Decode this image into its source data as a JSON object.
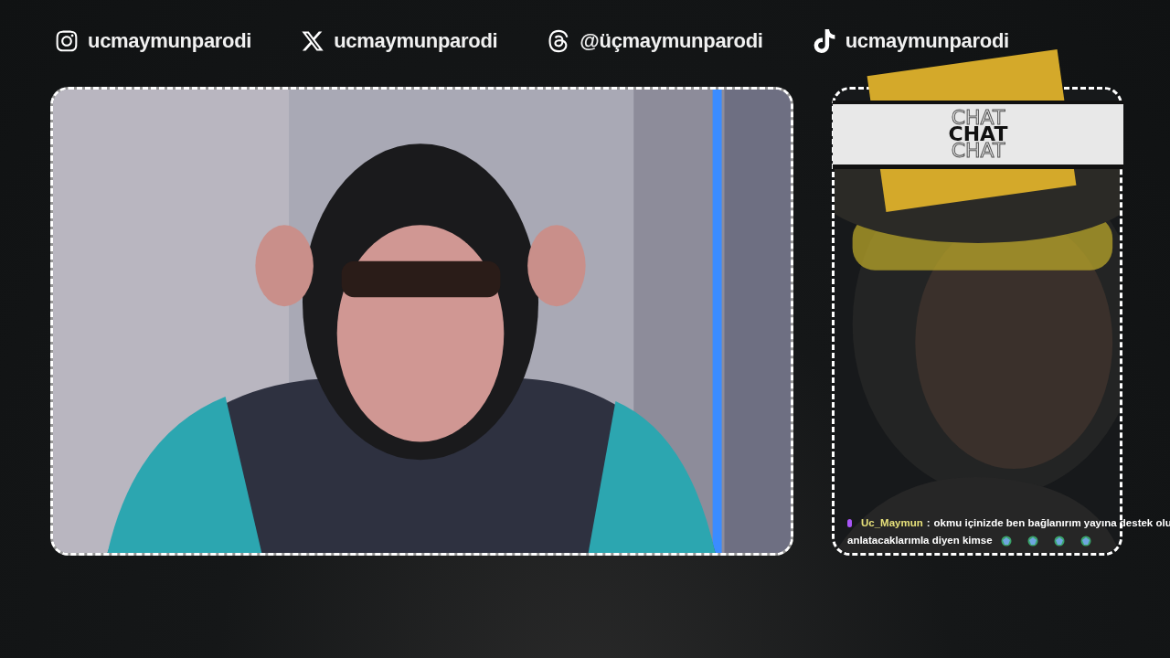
{
  "socials": [
    {
      "kind": "instagram",
      "handle": "ucmaymunparodi"
    },
    {
      "kind": "x",
      "handle": "ucmaymunparodi"
    },
    {
      "kind": "threads",
      "handle": "@üçmaymunparodi"
    },
    {
      "kind": "tiktok",
      "handle": "ucmaymunparodi"
    }
  ],
  "chat": {
    "header": [
      {
        "text": "CHAT",
        "kind": "outline"
      },
      {
        "text": "CHAT",
        "kind": "solid"
      },
      {
        "text": "CHAT",
        "kind": "outline"
      }
    ],
    "messages": [
      {
        "color": "#a855f7",
        "user": "Uc_Maymun",
        "separator": ":",
        "text_lines": [
          "okmu içinizde ben bağlanırım yayına destek olu",
          "anlatacaklarımla diyen kimse"
        ],
        "emotes": [
          {
            "kind": "globe"
          },
          {
            "kind": "globe"
          },
          {
            "kind": "globe"
          },
          {
            "kind": "globe"
          }
        ]
      }
    ]
  }
}
